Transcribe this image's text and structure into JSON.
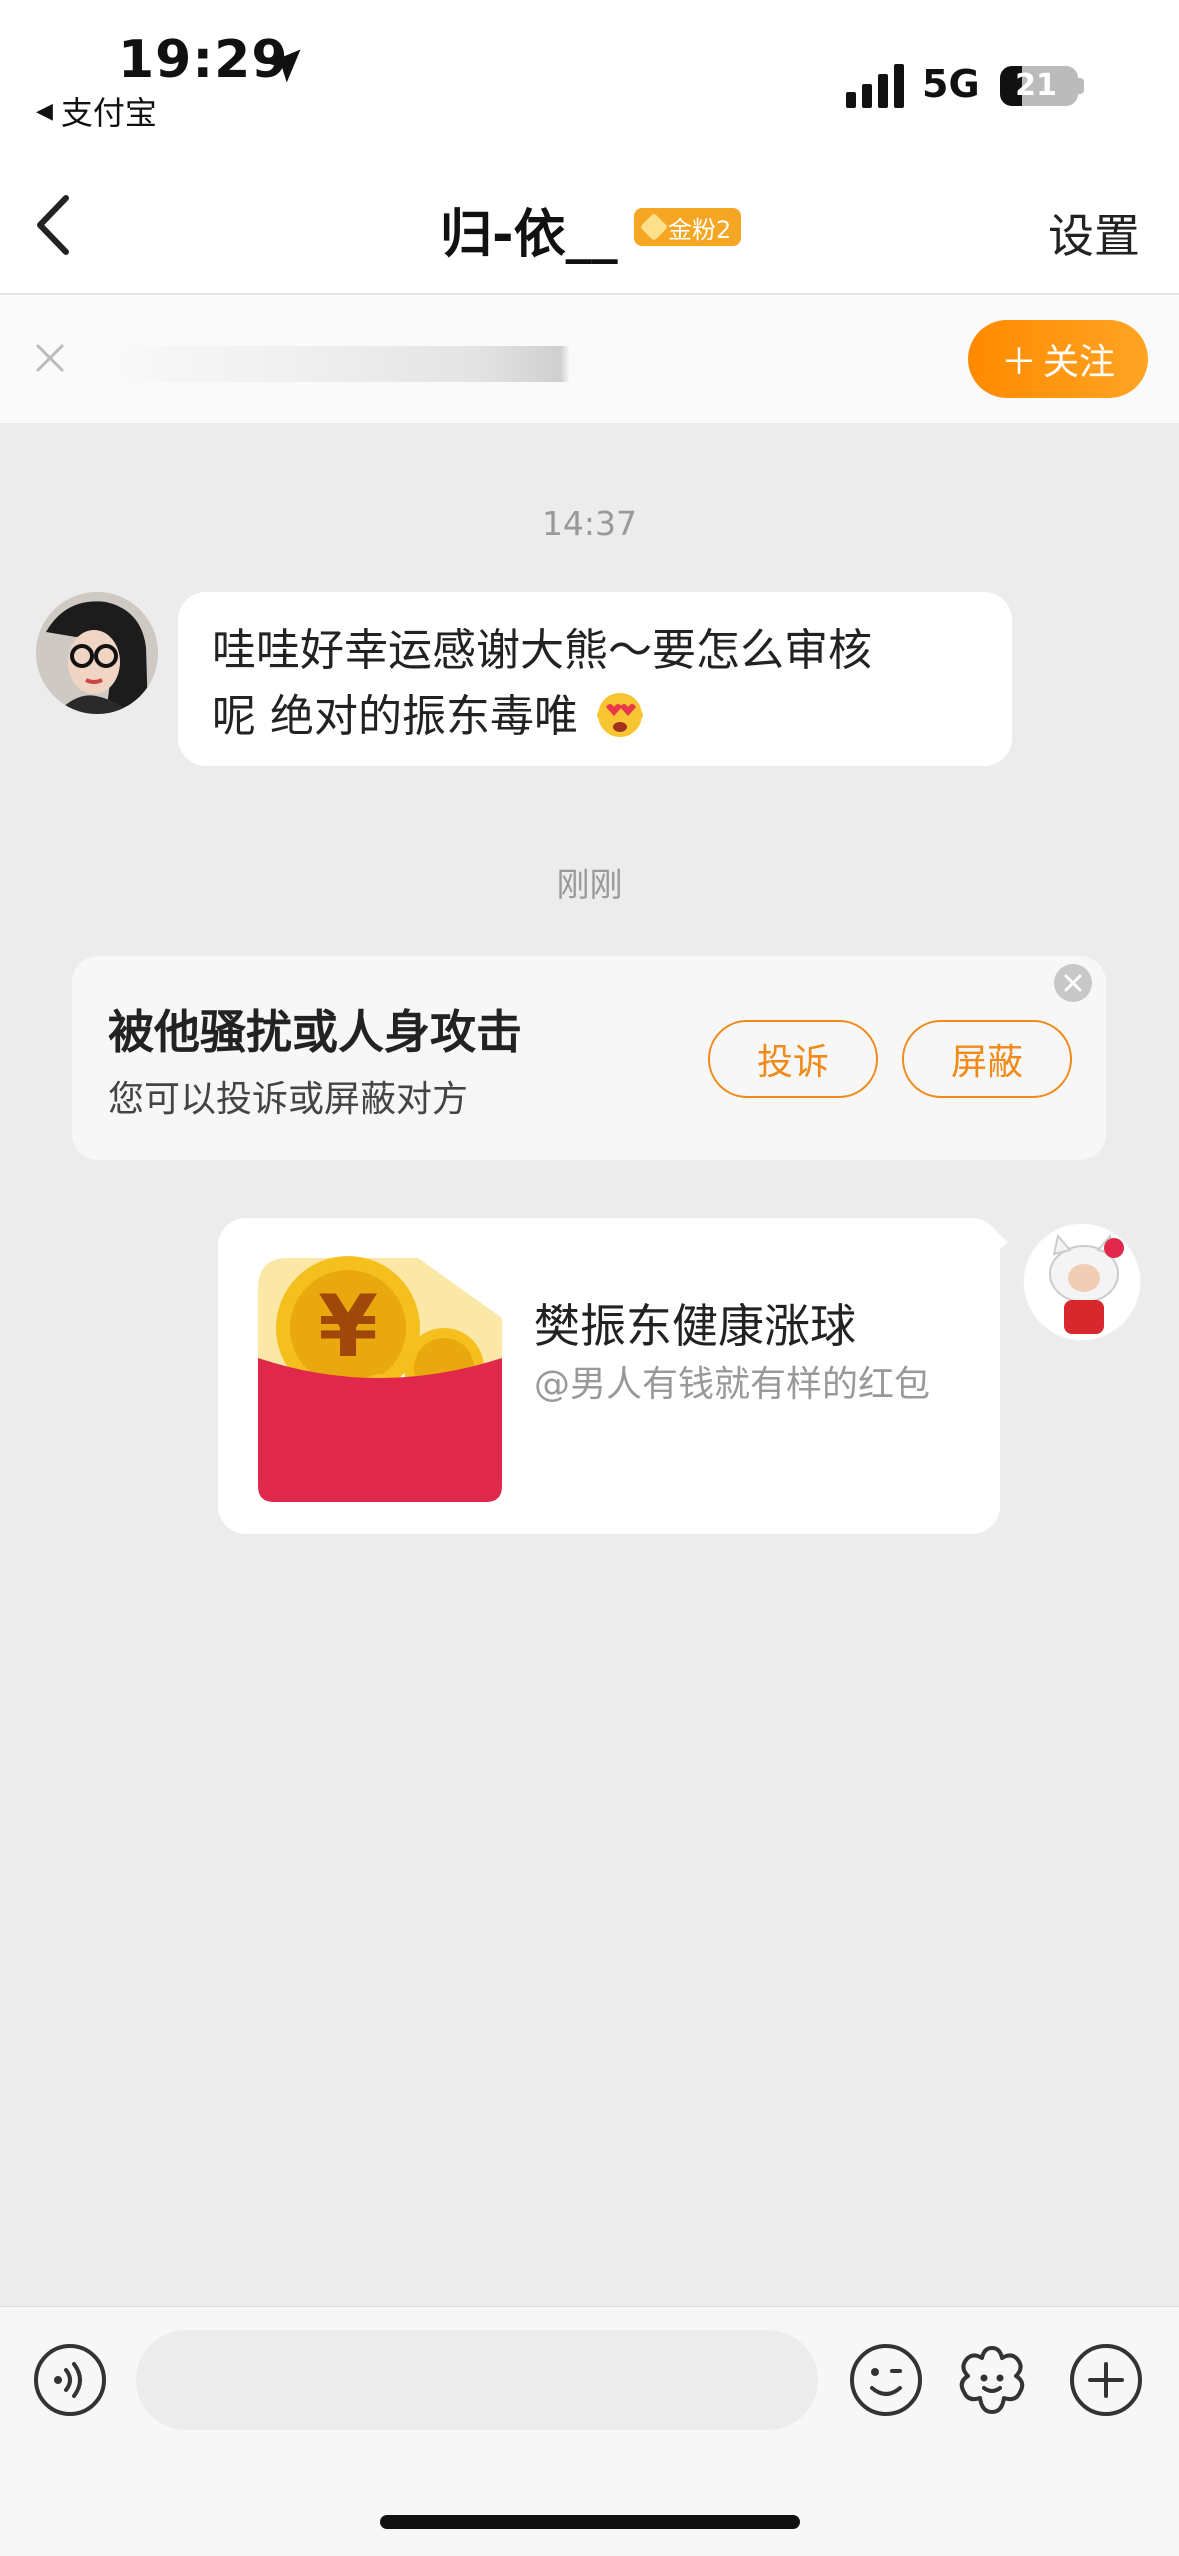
{
  "status_bar": {
    "time": "19:29",
    "back_app": "支付宝",
    "network": "5G",
    "battery": "21"
  },
  "nav": {
    "title": "归-依__",
    "fan_badge": "金粉2",
    "settings": "设置"
  },
  "follow_strip": {
    "follow_label": "关注",
    "follow_plus": "＋"
  },
  "chat": {
    "messages": [
      {
        "timestamp": "14:37",
        "text_line1": "哇哇好幸运感谢大熊～要怎么审核",
        "text_line2": "呢 绝对的振东毒唯"
      }
    ],
    "system_timestamp": "刚刚",
    "warning": {
      "title": "被他骚扰或人身攻击",
      "subtitle": "您可以投诉或屏蔽对方",
      "complain_label": "投诉",
      "block_label": "屏蔽"
    },
    "red_packet": {
      "title": "樊振东健康涨球",
      "subtitle": "@男人有钱就有样的红包"
    }
  },
  "icons": {
    "voice": "voice-icon",
    "emoji": "emoji-icon",
    "sticker": "sticker-icon",
    "plus": "plus-icon"
  },
  "colors": {
    "accent": "#ff8a00",
    "badge": "#f5a623",
    "red_packet": "#e0284a",
    "coin": "#f5c01e"
  }
}
